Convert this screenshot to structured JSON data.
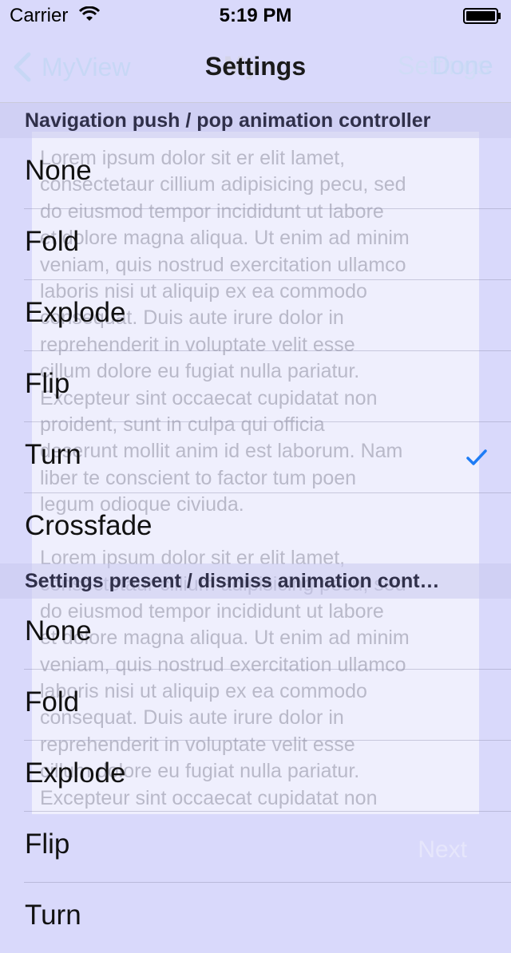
{
  "status_bar": {
    "carrier": "Carrier",
    "time": "5:19 PM",
    "icons": [
      "wifi-icon",
      "battery-icon"
    ]
  },
  "nav_bar": {
    "back_label": "MyView",
    "title": "Settings",
    "ghost_title": "My",
    "settings_ghost": "Settings",
    "done_label": "Done"
  },
  "background_view": {
    "paragraph_1": "Lorem ipsum dolor sit er elit lamet,\nconsectetaur cillium adipisicing pecu, sed\ndo eiusmod tempor incididunt ut labore\net dolore magna aliqua. Ut enim ad minim\nveniam, quis nostrud exercitation ullamco\nlaboris nisi ut aliquip ex ea commodo\nconsequat. Duis aute irure dolor in\nreprehenderit in voluptate velit esse\ncillum dolore eu fugiat nulla pariatur.\nExcepteur sint occaecat cupidatat non\nproident, sunt in culpa qui officia\ndeserunt mollit anim id est laborum. Nam\nliber te conscient to factor tum poen\nlegum odioque civiuda.",
    "paragraph_2": "Lorem ipsum dolor sit er elit lamet,\nconsectetaur cillium adipisicing pecu, sed\ndo eiusmod tempor incididunt ut labore\net dolore magna aliqua. Ut enim ad minim\nveniam, quis nostrud exercitation ullamco\nlaboris nisi ut aliquip ex ea commodo\nconsequat. Duis aute irure dolor in\nreprehenderit in voluptate velit esse\ncillum dolore eu fugiat nulla pariatur.\nExcepteur sint occaecat cupidatat non",
    "next_label": "Next"
  },
  "sections": [
    {
      "header": "Navigation push / pop animation controller",
      "options": [
        {
          "label": "None",
          "checked": false
        },
        {
          "label": "Fold",
          "checked": false
        },
        {
          "label": "Explode",
          "checked": false
        },
        {
          "label": "Flip",
          "checked": false
        },
        {
          "label": "Turn",
          "checked": true
        },
        {
          "label": "Crossfade",
          "checked": false
        }
      ]
    },
    {
      "header": "Settings present / dismiss animation cont…",
      "options": [
        {
          "label": "None",
          "checked": false
        },
        {
          "label": "Fold",
          "checked": false
        },
        {
          "label": "Explode",
          "checked": false
        },
        {
          "label": "Flip",
          "checked": false
        },
        {
          "label": "Turn",
          "checked": false
        }
      ]
    }
  ],
  "colors": {
    "accent": "#1e7cf5",
    "background": "#d9d9fb"
  }
}
